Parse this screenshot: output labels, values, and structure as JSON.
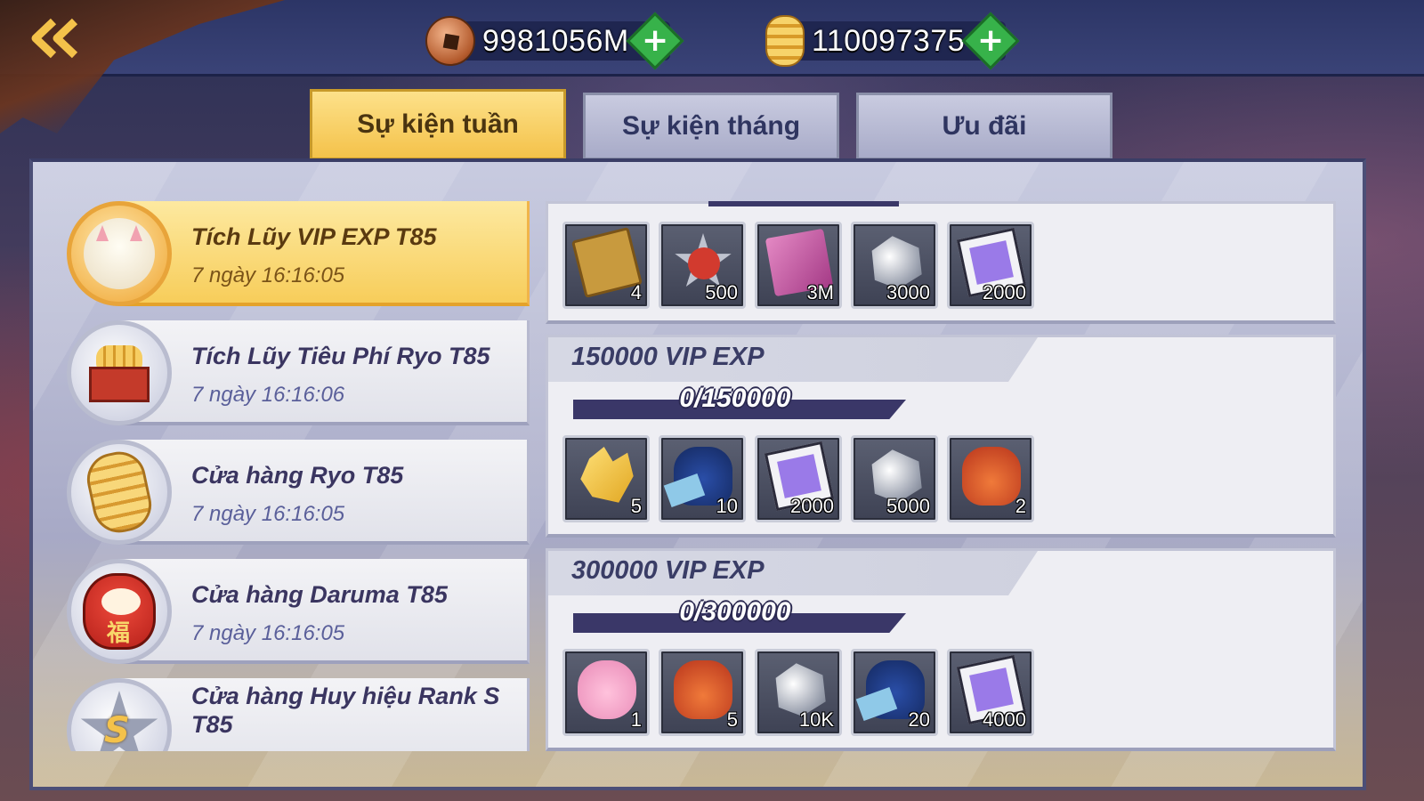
{
  "header": {
    "copper": {
      "icon": "copper-coin-icon",
      "value": "9981056M"
    },
    "gold": {
      "icon": "gold-ryo-icon",
      "value": "110097375"
    }
  },
  "tabs": [
    {
      "label": "Sự kiện tuần",
      "active": true
    },
    {
      "label": "Sự kiện tháng",
      "active": false
    },
    {
      "label": "Ưu đãi",
      "active": false
    }
  ],
  "events": [
    {
      "title": "Tích Lũy VIP EXP T85",
      "timer": "7 ngày 16:16:05",
      "icon": "lucky-cat-icon",
      "active": true
    },
    {
      "title": "Tích Lũy Tiêu Phí Ryo T85",
      "timer": "7 ngày 16:16:06",
      "icon": "ryo-basket-icon",
      "active": false
    },
    {
      "title": "Cửa hàng Ryo T85",
      "timer": "7 ngày 16:16:05",
      "icon": "ryo-icon",
      "active": false
    },
    {
      "title": "Cửa hàng Daruma T85",
      "timer": "7 ngày 16:16:05",
      "icon": "daruma-icon",
      "active": false
    },
    {
      "title": "Cửa hàng Huy hiệu Rank S T85",
      "timer": "",
      "icon": "rank-s-badge-icon",
      "active": false
    }
  ],
  "tiers": [
    {
      "label": "",
      "progress": "",
      "items": [
        {
          "icon": "music-card-icon",
          "qty": "4"
        },
        {
          "icon": "ss-badge-icon",
          "qty": "500"
        },
        {
          "icon": "skill-book-icon",
          "qty": "3M"
        },
        {
          "icon": "silver-ore-icon",
          "qty": "3000"
        },
        {
          "icon": "purple-scroll-icon",
          "qty": "2000"
        }
      ]
    },
    {
      "label": "150000 VIP EXP",
      "progress": "0/150000",
      "progress_fraction": 0,
      "items": [
        {
          "icon": "gold-crystal-icon",
          "qty": "5"
        },
        {
          "icon": "blue-ninja-bag-icon",
          "qty": "10"
        },
        {
          "icon": "purple-scroll-icon",
          "qty": "2000"
        },
        {
          "icon": "silver-ore-icon",
          "qty": "5000"
        },
        {
          "icon": "red-lucky-bag-icon",
          "qty": "2"
        }
      ]
    },
    {
      "label": "300000 VIP EXP",
      "progress": "0/300000",
      "progress_fraction": 0,
      "items": [
        {
          "icon": "pink-bag-icon",
          "qty": "1"
        },
        {
          "icon": "red-lucky-bag-icon",
          "qty": "5"
        },
        {
          "icon": "silver-ore-icon",
          "qty": "10K"
        },
        {
          "icon": "blue-ninja-bag-icon",
          "qty": "20"
        },
        {
          "icon": "purple-scroll-icon",
          "qty": "4000"
        }
      ]
    }
  ]
}
